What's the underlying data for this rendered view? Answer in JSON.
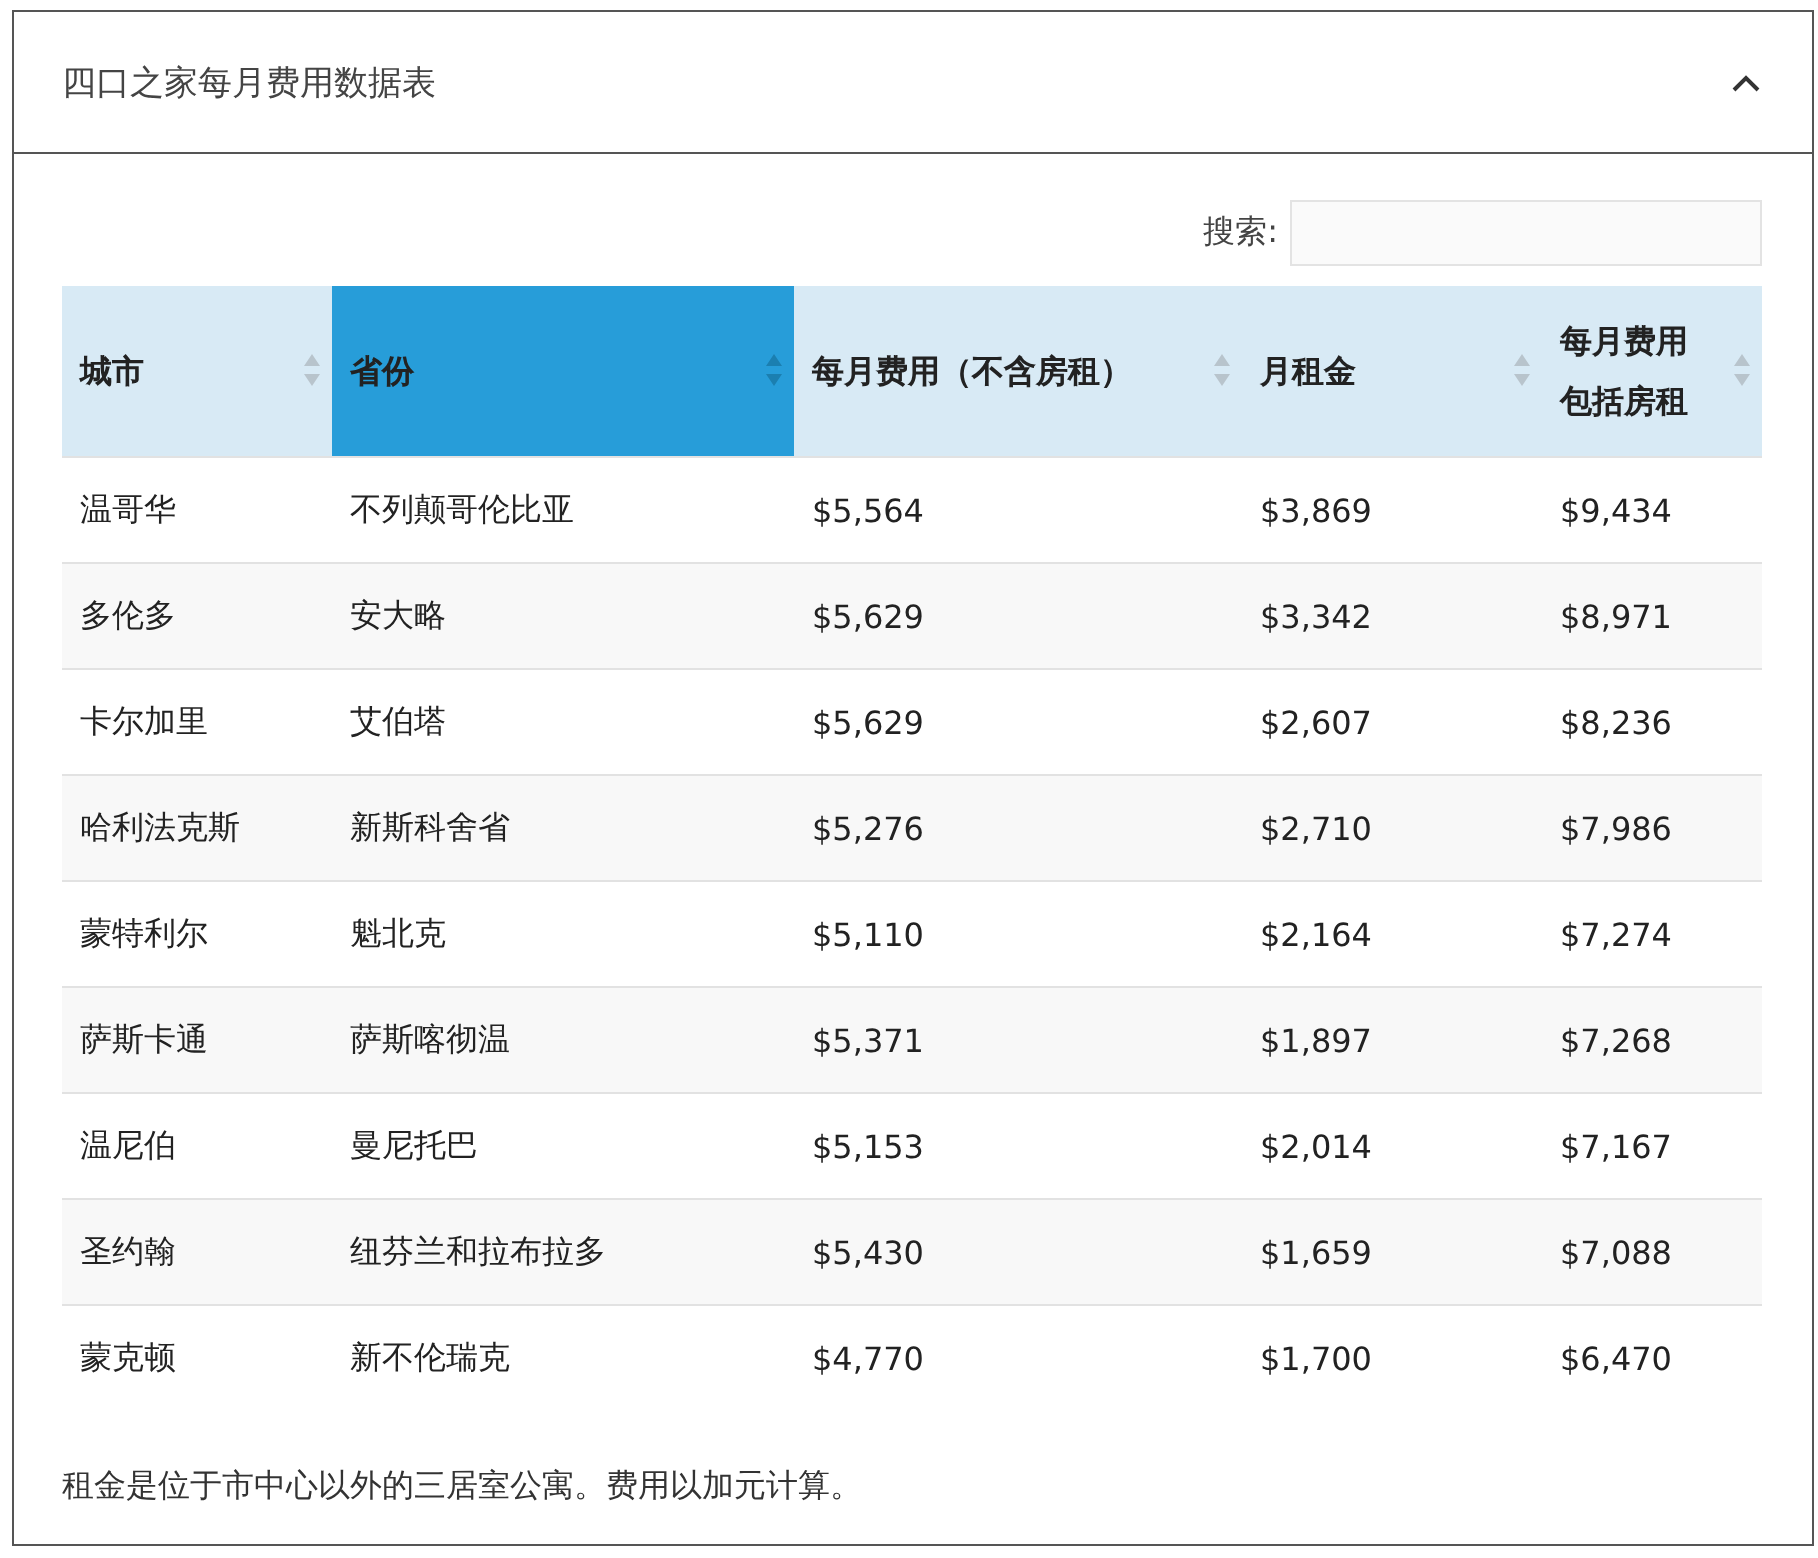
{
  "panel": {
    "title": "四口之家每月费用数据表",
    "expanded": true
  },
  "search": {
    "label": "搜索:"
  },
  "table": {
    "columns": [
      {
        "label": "城市",
        "selected": false
      },
      {
        "label": "省份",
        "selected": true
      },
      {
        "label": "每月费用（不含房租）",
        "selected": false
      },
      {
        "label": "月租金",
        "selected": false
      },
      {
        "label": "每月费用包括房租",
        "selected": false
      }
    ],
    "rows": [
      [
        "温哥华",
        "不列颠哥伦比亚",
        "$5,564",
        "$3,869",
        "$9,434"
      ],
      [
        "多伦多",
        "安大略",
        "$5,629",
        "$3,342",
        "$8,971"
      ],
      [
        "卡尔加里",
        "艾伯塔",
        "$5,629",
        "$2,607",
        "$8,236"
      ],
      [
        "哈利法克斯",
        "新斯科舍省",
        "$5,276",
        "$2,710",
        "$7,986"
      ],
      [
        "蒙特利尔",
        "魁北克",
        "$5,110",
        "$2,164",
        "$7,274"
      ],
      [
        "萨斯卡通",
        "萨斯喀彻温",
        "$5,371",
        "$1,897",
        "$7,268"
      ],
      [
        "温尼伯",
        "曼尼托巴",
        "$5,153",
        "$2,014",
        "$7,167"
      ],
      [
        "圣约翰",
        "纽芬兰和拉布拉多",
        "$5,430",
        "$1,659",
        "$7,088"
      ],
      [
        "蒙克顿",
        "新不伦瑞克",
        "$4,770",
        "$1,700",
        "$6,470"
      ]
    ]
  },
  "footnote": "租金是位于市中心以外的三居室公寓。费用以加元计算。"
}
